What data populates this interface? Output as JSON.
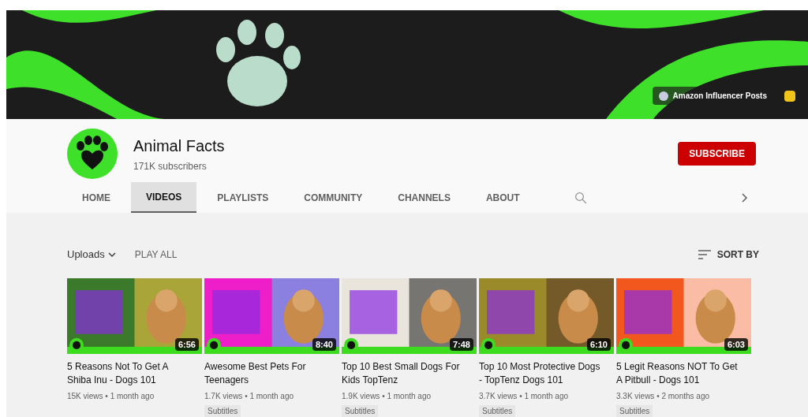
{
  "banner": {
    "kind": "picture",
    "link": {
      "label": "Amazon Influencer Posts"
    }
  },
  "channel": {
    "name": "Animal Facts",
    "subscribers": "171K subscribers",
    "subscribe": "SUBSCRIBE"
  },
  "tabs": [
    {
      "label": "HOME",
      "selected": false
    },
    {
      "label": "VIDEOS",
      "selected": true
    },
    {
      "label": "PLAYLISTS",
      "selected": false
    },
    {
      "label": "COMMUNITY",
      "selected": false
    },
    {
      "label": "CHANNELS",
      "selected": false
    },
    {
      "label": "ABOUT",
      "selected": false
    }
  ],
  "toolbar": {
    "uploads": "Uploads",
    "play_all": "PLAY ALL",
    "sort_by": "SORT BY"
  },
  "videos": [
    {
      "title": "5 Reasons Not To Get A Shiba Inu - Dogs 101",
      "duration": "6:56",
      "meta": "15K views • 1 month ago",
      "color": "#3a7a2a"
    },
    {
      "title": "Awesome Best Pets For Teenagers",
      "duration": "8:40",
      "meta": "1.7K views • 1 month ago",
      "badge": "Subtitles",
      "color": "#ee1ec8"
    },
    {
      "title": "Top 10 Best Small Dogs For Kids TopTenz",
      "duration": "7:48",
      "meta": "1.9K views • 1 month ago",
      "badge": "Subtitles",
      "color": "#e9e4dc"
    },
    {
      "title": "Top 10 Most Protective Dogs - TopTenz Dogs 101",
      "duration": "6:10",
      "meta": "3.7K views • 1 month ago",
      "badge": "Subtitles",
      "color": "#9b8a2a"
    },
    {
      "title": "5 Legit Reasons NOT To Get A Pitbull - Dogs 101",
      "duration": "6:03",
      "meta": "3.3K views • 2 months ago",
      "badge": "Subtitles",
      "color": "#f2581e"
    }
  ]
}
